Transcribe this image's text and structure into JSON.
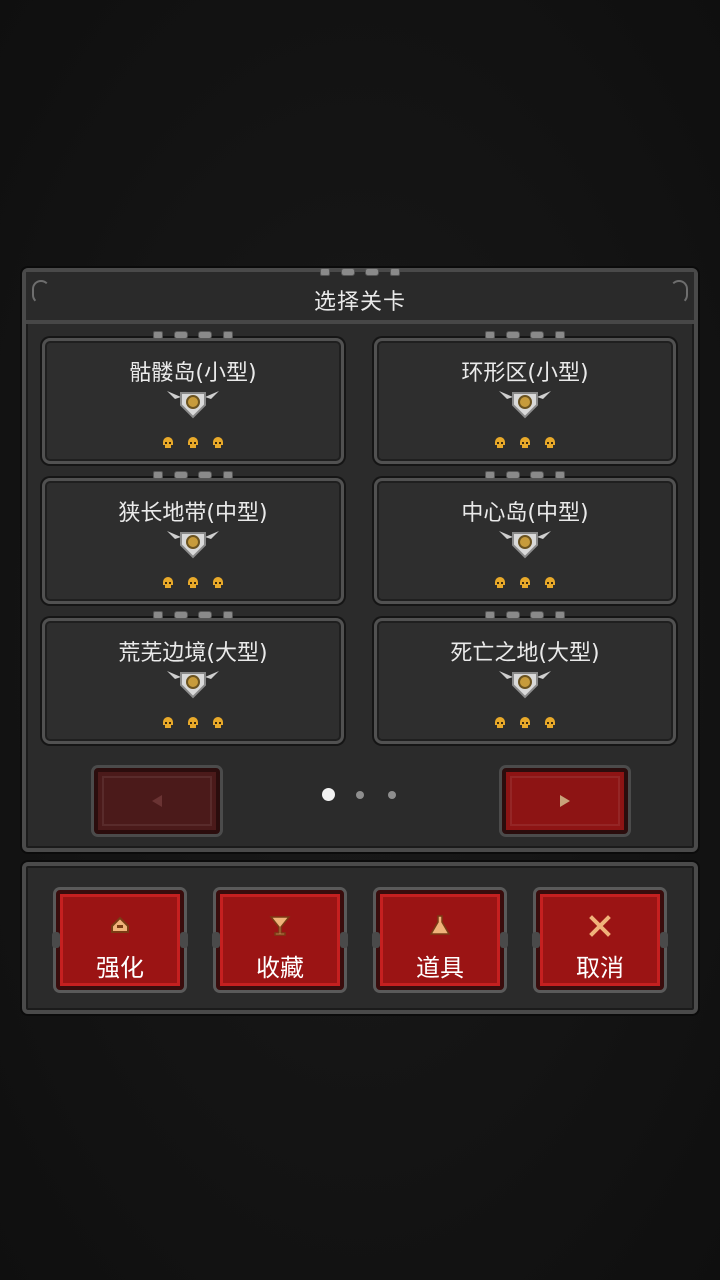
{
  "dialog": {
    "title": "选择关卡"
  },
  "levels": [
    {
      "name": "骷髅岛(小型)",
      "skulls": 3
    },
    {
      "name": "环形区(小型)",
      "skulls": 3
    },
    {
      "name": "狭长地带(中型)",
      "skulls": 3
    },
    {
      "name": "中心岛(中型)",
      "skulls": 3
    },
    {
      "name": "荒芜边境(大型)",
      "skulls": 3
    },
    {
      "name": "死亡之地(大型)",
      "skulls": 3
    }
  ],
  "pager": {
    "current_page": 1,
    "total_pages": 3,
    "prev_icon": "triangle-left-icon",
    "next_icon": "triangle-right-icon"
  },
  "actions": [
    {
      "label": "强化",
      "icon": "upgrade-icon"
    },
    {
      "label": "收藏",
      "icon": "goblet-icon"
    },
    {
      "label": "道具",
      "icon": "flask-icon"
    },
    {
      "label": "取消",
      "icon": "close-icon"
    }
  ],
  "colors": {
    "background": "#121212",
    "panel": "#2b2b2b",
    "panel_border": "#4a4a4a",
    "button_red": "#9b1414",
    "skull_gold": "#e8a92a",
    "text": "#eaeaea"
  }
}
